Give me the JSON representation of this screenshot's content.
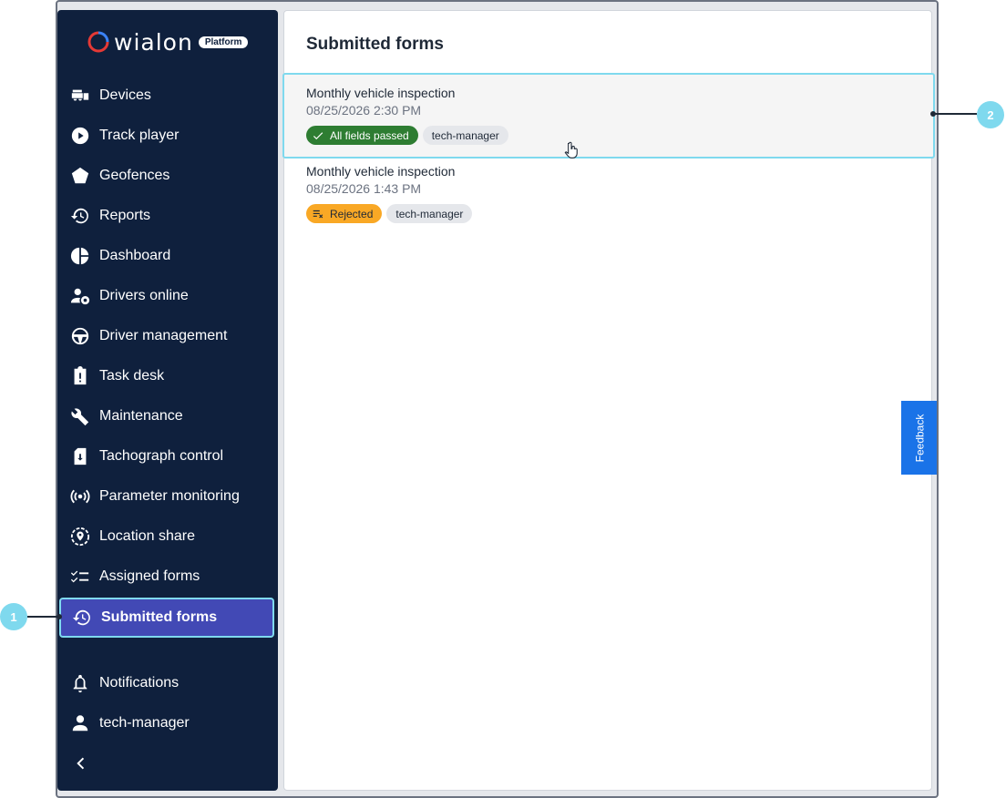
{
  "brand": {
    "name": "wialon",
    "badge": "Platform",
    "accent": "#e53935"
  },
  "sidebar": {
    "items": [
      {
        "label": "Devices",
        "icon": "devices-icon"
      },
      {
        "label": "Track player",
        "icon": "play-icon"
      },
      {
        "label": "Geofences",
        "icon": "pentagon-icon"
      },
      {
        "label": "Reports",
        "icon": "history-icon"
      },
      {
        "label": "Dashboard",
        "icon": "pie-chart-icon"
      },
      {
        "label": "Drivers online",
        "icon": "driver-online-icon"
      },
      {
        "label": "Driver management",
        "icon": "steering-wheel-icon"
      },
      {
        "label": "Task desk",
        "icon": "clipboard-alert-icon"
      },
      {
        "label": "Maintenance",
        "icon": "wrench-icon"
      },
      {
        "label": "Tachograph control",
        "icon": "tachograph-icon"
      },
      {
        "label": "Parameter monitoring",
        "icon": "sensor-icon"
      },
      {
        "label": "Location share",
        "icon": "location-share-icon"
      },
      {
        "label": "Assigned forms",
        "icon": "checklist-icon"
      },
      {
        "label": "Submitted forms",
        "icon": "history-icon",
        "active": true
      }
    ],
    "bottom": [
      {
        "label": "Notifications",
        "icon": "bell-icon"
      },
      {
        "label": "tech-manager",
        "icon": "user-icon"
      }
    ],
    "collapse_icon": "chevron-left-icon"
  },
  "main": {
    "title": "Submitted forms",
    "forms": [
      {
        "title": "Monthly vehicle inspection",
        "date": "08/25/2026 2:30 PM",
        "status": "All fields passed",
        "status_type": "passed",
        "tag": "tech-manager"
      },
      {
        "title": "Monthly vehicle inspection",
        "date": "08/25/2026 1:43 PM",
        "status": "Rejected",
        "status_type": "rejected",
        "tag": "tech-manager"
      }
    ]
  },
  "feedback": {
    "label": "Feedback"
  },
  "callouts": [
    {
      "label": "1"
    },
    {
      "label": "2"
    }
  ],
  "colors": {
    "sidebar_bg": "#0f203d",
    "active_bg": "#4249b5",
    "highlight": "#7fd9ee",
    "passed": "#2e7d32",
    "rejected": "#f9a825",
    "feedback": "#1a73e8"
  }
}
